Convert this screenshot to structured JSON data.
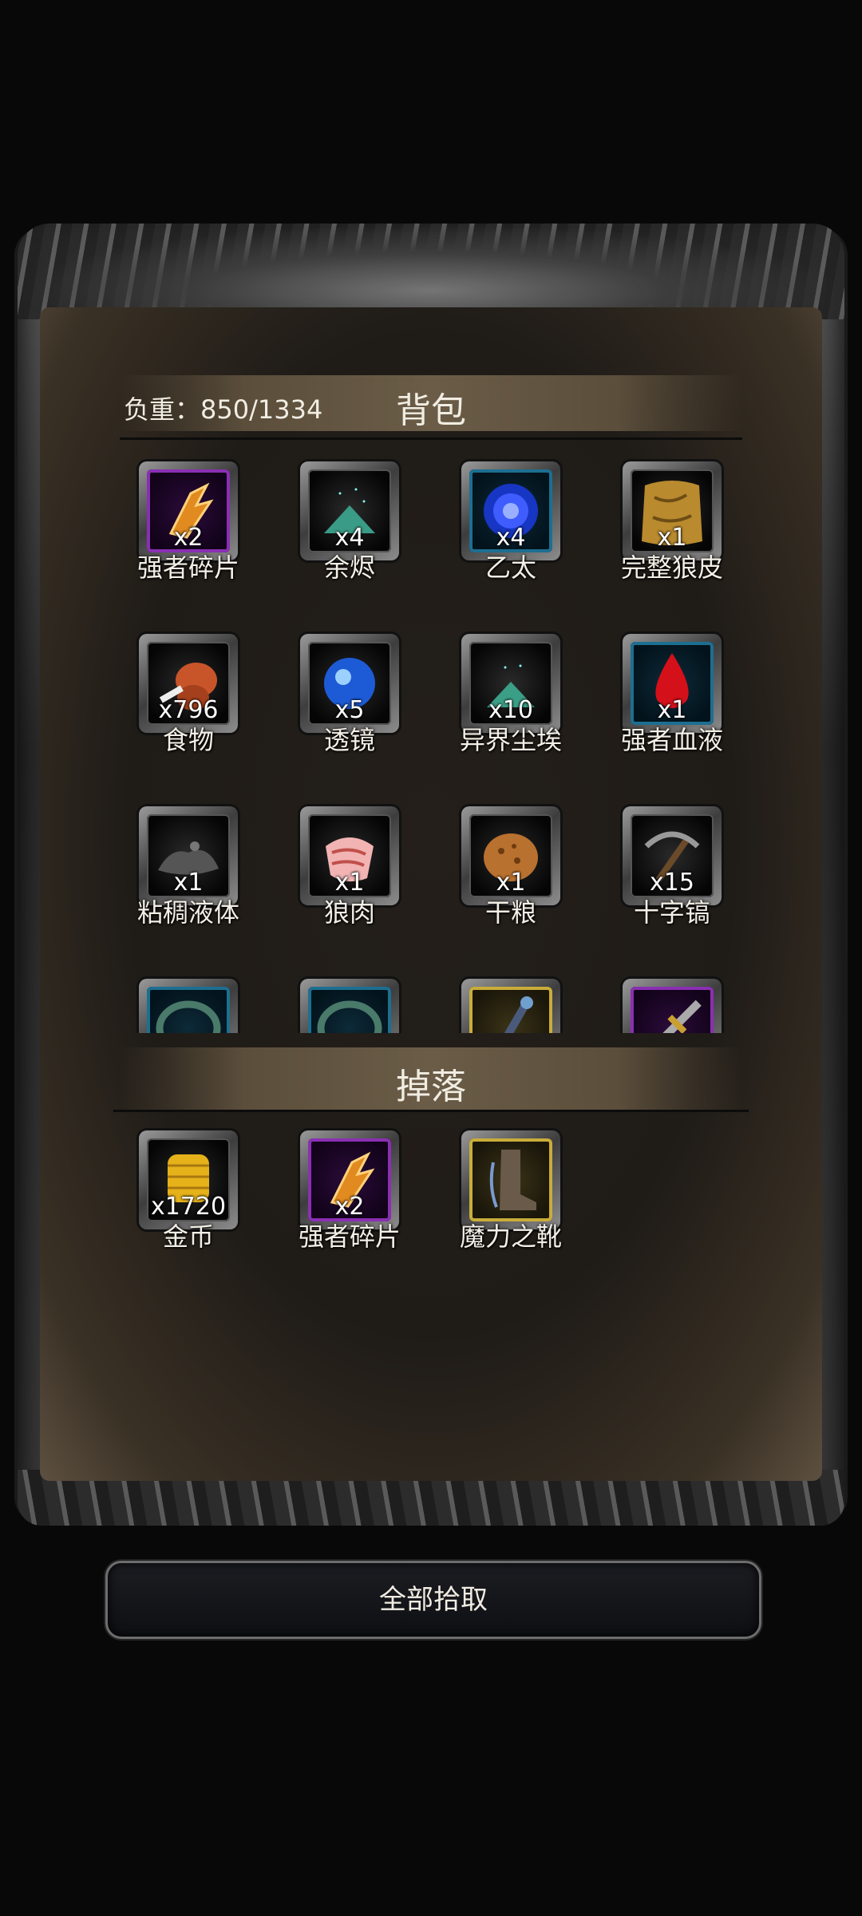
{
  "bag": {
    "load_label": "负重：850/1334",
    "title": "背包",
    "items": [
      {
        "name": "强者碎片",
        "qty": "x2",
        "rarity": "purple",
        "icon": "shard-icon"
      },
      {
        "name": "余烬",
        "qty": "x4",
        "rarity": "gray",
        "icon": "ember-pile-icon"
      },
      {
        "name": "乙太",
        "qty": "x4",
        "rarity": "blue",
        "icon": "ether-orb-icon"
      },
      {
        "name": "完整狼皮",
        "qty": "x1",
        "rarity": "gray",
        "icon": "wolf-pelt-icon"
      },
      {
        "name": "食物",
        "qty": "x796",
        "rarity": "gray",
        "icon": "meat-drumstick-icon"
      },
      {
        "name": "透镜",
        "qty": "x5",
        "rarity": "gray",
        "icon": "lens-icon"
      },
      {
        "name": "异界尘埃",
        "qty": "x10",
        "rarity": "gray",
        "icon": "dust-pile-icon"
      },
      {
        "name": "强者血液",
        "qty": "x1",
        "rarity": "blue",
        "icon": "blood-drop-icon"
      },
      {
        "name": "粘稠液体",
        "qty": "x1",
        "rarity": "gray",
        "icon": "slime-icon"
      },
      {
        "name": "狼肉",
        "qty": "x1",
        "rarity": "gray",
        "icon": "raw-meat-icon"
      },
      {
        "name": "干粮",
        "qty": "x1",
        "rarity": "gray",
        "icon": "bread-icon"
      },
      {
        "name": "十字镐",
        "qty": "x15",
        "rarity": "gray",
        "icon": "pickaxe-icon"
      },
      {
        "name": "",
        "qty": "",
        "rarity": "blue",
        "icon": "ring-icon"
      },
      {
        "name": "",
        "qty": "",
        "rarity": "blue",
        "icon": "ring-icon"
      },
      {
        "name": "",
        "qty": "",
        "rarity": "gold",
        "icon": "wand-icon"
      },
      {
        "name": "",
        "qty": "",
        "rarity": "purple",
        "icon": "sword-icon"
      }
    ]
  },
  "drops": {
    "title": "掉落",
    "items": [
      {
        "name": "金币",
        "qty": "x1720",
        "rarity": "gray",
        "icon": "gold-coins-icon"
      },
      {
        "name": "强者碎片",
        "qty": "x2",
        "rarity": "purple",
        "icon": "shard-icon"
      },
      {
        "name": "魔力之靴",
        "qty": "",
        "rarity": "gold",
        "icon": "boots-icon"
      }
    ]
  },
  "actions": {
    "pickup_all": "全部拾取"
  },
  "colors": {
    "rarity_blue": "#1d6f91",
    "rarity_purple": "#8a2fb3",
    "rarity_gold": "#c9ad3a",
    "rarity_gray": "#555555"
  }
}
